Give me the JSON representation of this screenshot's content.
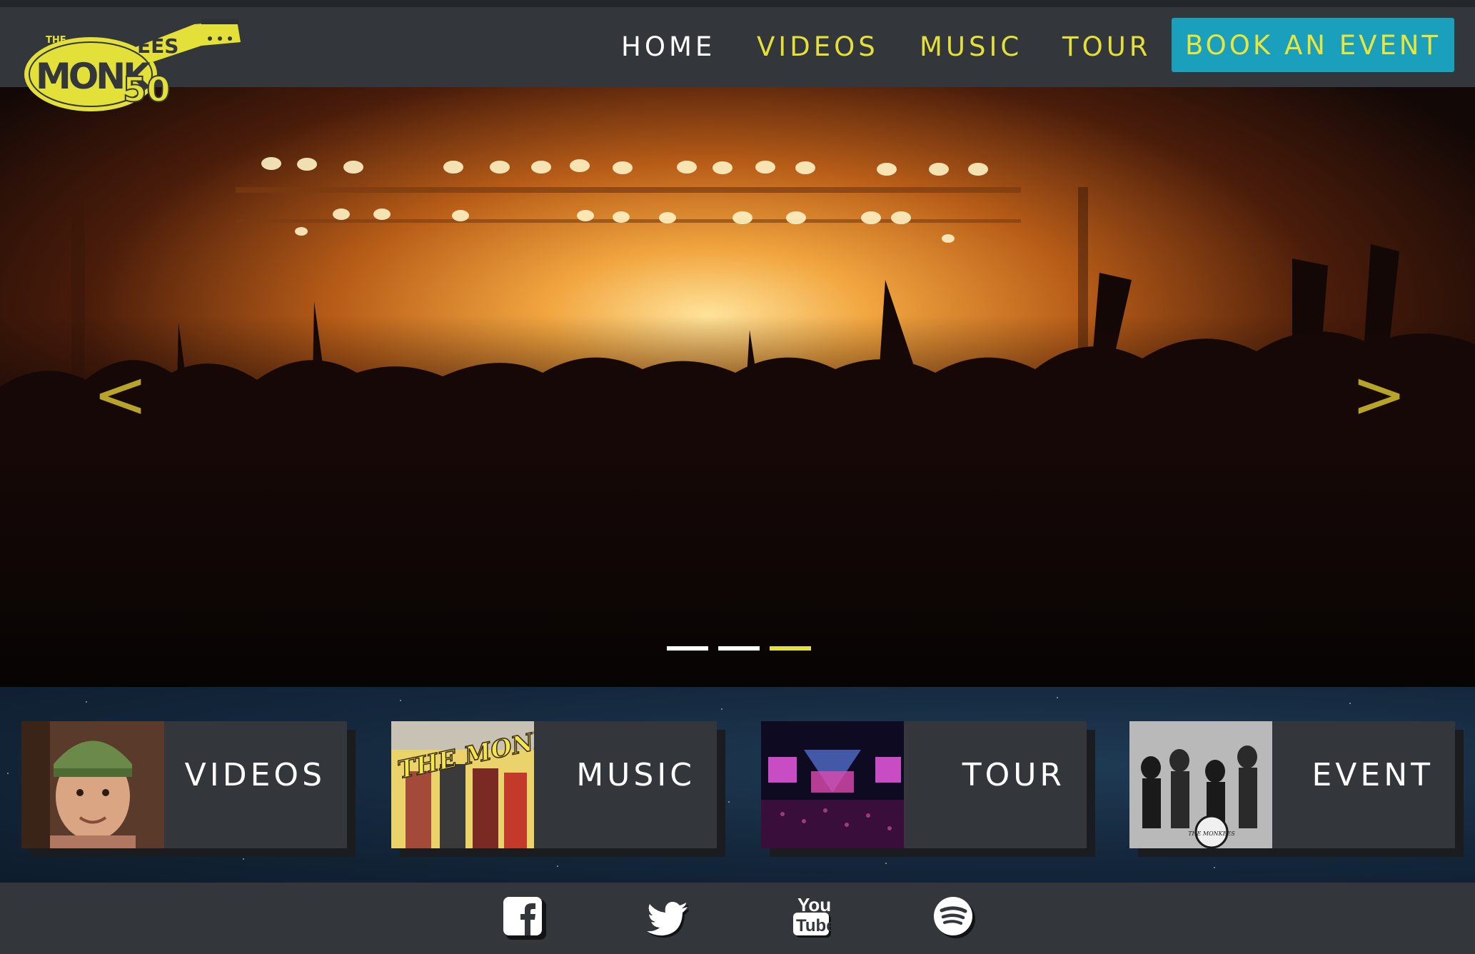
{
  "nav": {
    "home": "HOME",
    "videos": "VIDEOS",
    "music": "MUSIC",
    "tour": "TOUR",
    "book": "BOOK AN EVENT"
  },
  "logo": {
    "top": "THE",
    "word": "MONKEES",
    "number": "50"
  },
  "hero": {
    "prev_arrow": "<",
    "next_arrow": ">",
    "slides": 3,
    "active_slide": 3
  },
  "cards": [
    {
      "label": "VIDEOS"
    },
    {
      "label": "MUSIC",
      "thumb_text": "THE MONKEES"
    },
    {
      "label": "TOUR"
    },
    {
      "label": "EVENT",
      "thumb_text": "THE MONKEES"
    }
  ],
  "footer": {
    "youtube_top": "You",
    "youtube_bottom": "Tube"
  },
  "colors": {
    "accent_yellow": "#e4e03a",
    "button_blue": "#1a9fbd",
    "bar_dark": "#33373c"
  },
  "icons": [
    "facebook-icon",
    "twitter-icon",
    "youtube-icon",
    "spotify-icon",
    "chevron-left-icon",
    "chevron-right-icon"
  ]
}
